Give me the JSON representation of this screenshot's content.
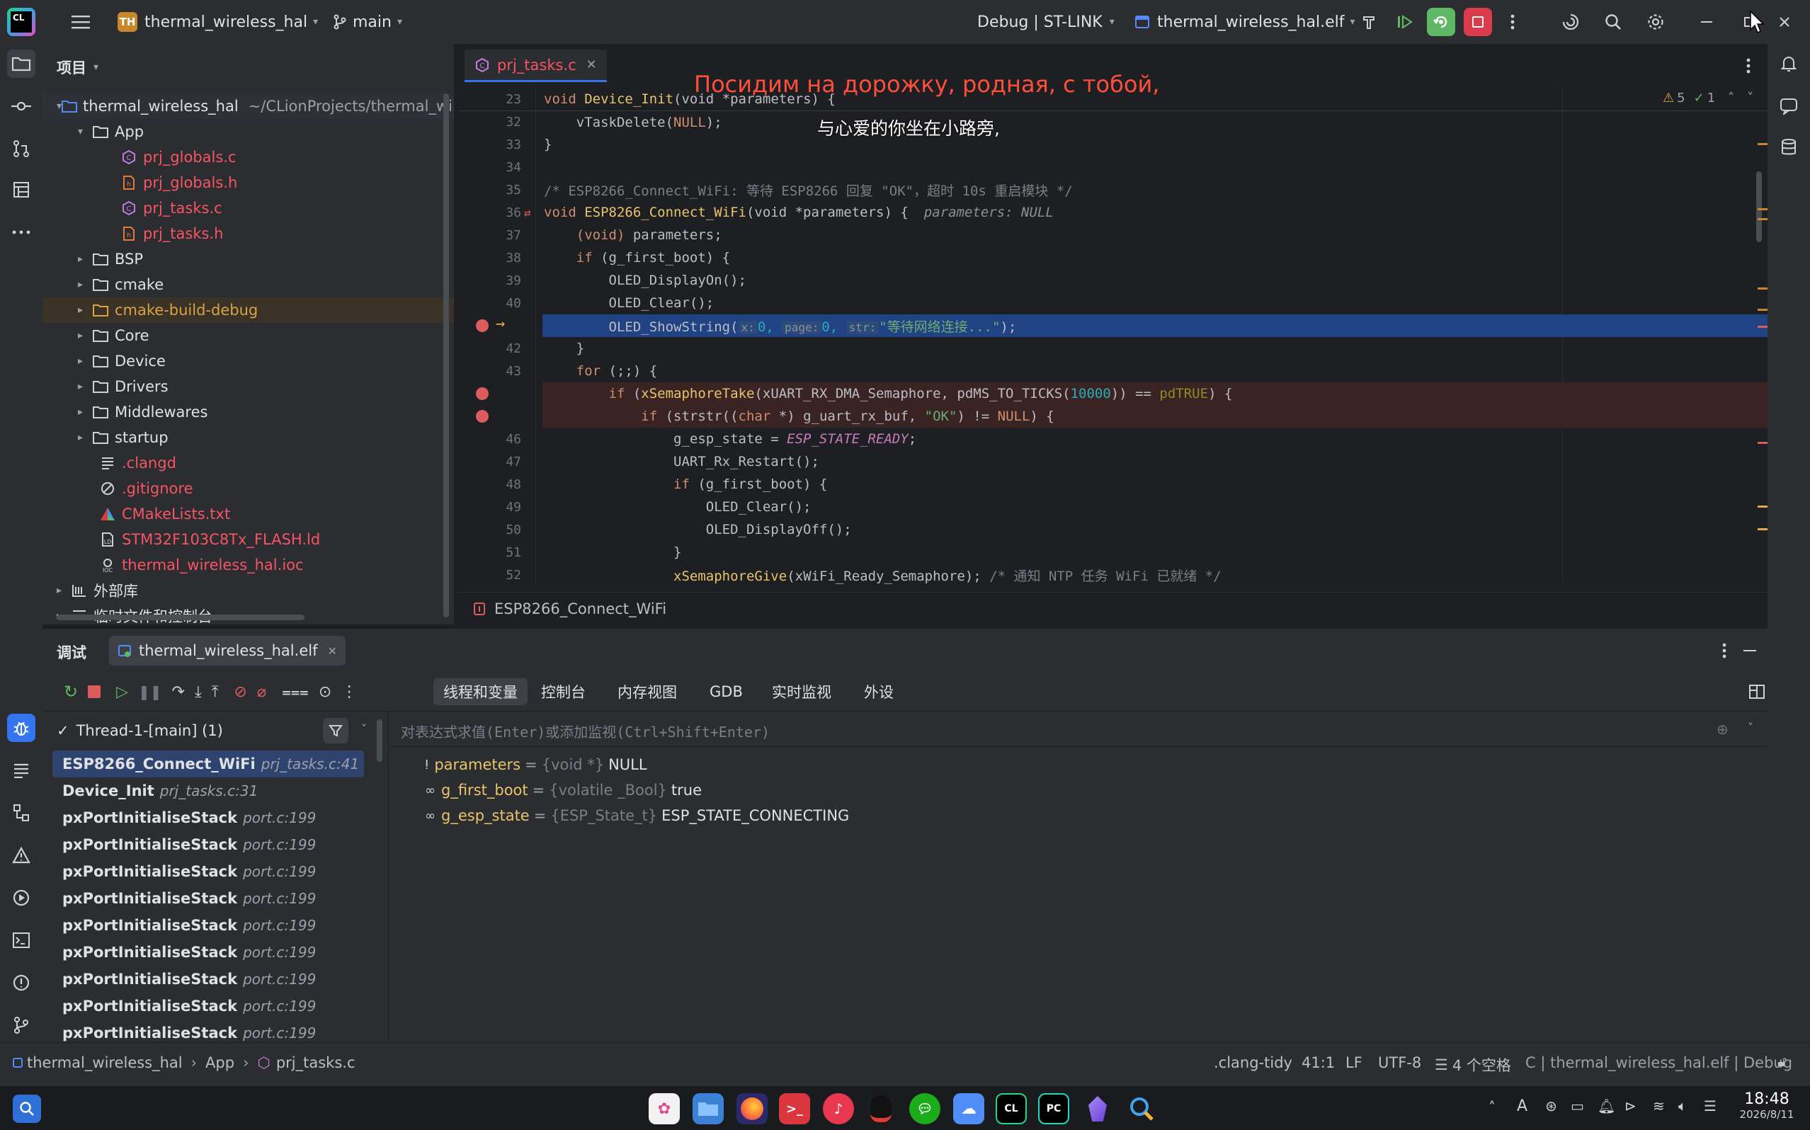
{
  "titlebar": {
    "project_badge": "TH",
    "project_name": "thermal_wireless_hal",
    "branch": "main",
    "run_config": "Debug | ST-LINK",
    "target": "thermal_wireless_hal.elf"
  },
  "project_panel": {
    "title": "项目",
    "root_name": "thermal_wireless_hal",
    "root_path": "~/CLionProjects/thermal_wire",
    "items": [
      {
        "label": "App",
        "type": "folder"
      },
      {
        "label": "prj_globals.c",
        "type": "c-file"
      },
      {
        "label": "prj_globals.h",
        "type": "h-file"
      },
      {
        "label": "prj_tasks.c",
        "type": "c-file"
      },
      {
        "label": "prj_tasks.h",
        "type": "h-file"
      },
      {
        "label": "BSP",
        "type": "folder"
      },
      {
        "label": "cmake",
        "type": "folder"
      },
      {
        "label": "cmake-build-debug",
        "type": "folder"
      },
      {
        "label": "Core",
        "type": "folder"
      },
      {
        "label": "Device",
        "type": "folder"
      },
      {
        "label": "Drivers",
        "type": "folder"
      },
      {
        "label": "Middlewares",
        "type": "folder"
      },
      {
        "label": "startup",
        "type": "folder"
      },
      {
        "label": ".clangd",
        "type": "file"
      },
      {
        "label": ".gitignore",
        "type": "file"
      },
      {
        "label": "CMakeLists.txt",
        "type": "file"
      },
      {
        "label": "STM32F103C8Tx_FLASH.ld",
        "type": "file"
      },
      {
        "label": "thermal_wireless_hal.ioc",
        "type": "file"
      },
      {
        "label": "外部库",
        "type": "lib"
      },
      {
        "label": "临时文件和控制台",
        "type": "scratch"
      }
    ]
  },
  "editor": {
    "tab_label": "prj_tasks.c",
    "warnings": "5",
    "checks": "1",
    "breadcrumb_fn": "ESP8266_Connect_WiFi",
    "overlay_lyric_1": "Посидим на дорожку, родная, с тобой,",
    "overlay_lyric_2": "与心爱的你坐在小路旁,",
    "line_numbers": [
      "23",
      "32",
      "33",
      "34",
      "35",
      "36",
      "37",
      "38",
      "39",
      "40",
      "",
      "42",
      "43",
      "",
      "",
      "46",
      "47",
      "48",
      "49",
      "50",
      "51",
      "52"
    ],
    "lines": {
      "l23a": "void ",
      "l23b": "Device_Init",
      "l23c": "(void *parameters) {",
      "l32a": "    vTaskDelete(",
      "l32b": "NULL",
      "l32c": ");",
      "l33": "}",
      "l35": "/* ESP8266_Connect_WiFi: 等待 ESP8266 回复 \"OK\"，超时 10s 重启模块 */",
      "l36a": "void ",
      "l36b": "ESP8266_Connect_WiFi",
      "l36c": "(void *parameters) {",
      "l36hint": "parameters: NULL",
      "l37a": "    (void) ",
      "l37b": "parameters;",
      "l38a": "    if ",
      "l38b": "(g_first_boot) {",
      "l39": "        OLED_DisplayOn();",
      "l40": "        OLED_Clear();",
      "l41a": "        OLED_ShowString(",
      "l41x": "x:",
      "l41xv": "0,",
      "l41p": "page:",
      "l41pv": "0,",
      "l41s": "str:",
      "l41sv": "\"等待网络连接...\"",
      "l41e": ");",
      "l42": "    }",
      "l43a": "    for ",
      "l43b": "(;;) {",
      "l44a": "        if ",
      "l44b": "(",
      "l44c": "xSemaphoreTake",
      "l44d": "(xUART_RX_DMA_Semaphore, pdMS_TO_TICKS(",
      "l44e": "10000",
      "l44f": ")) == ",
      "l44g": "pdTRUE",
      "l44h": ") {",
      "l45a": "            if ",
      "l45b": "(strstr((",
      "l45c": "char ",
      "l45d": "*) g_uart_rx_buf, ",
      "l45e": "\"OK\"",
      "l45f": ") != ",
      "l45g": "NULL",
      "l45h": ") {",
      "l46a": "                g_esp_state = ",
      "l46b": "ESP_STATE_READY",
      "l46c": ";",
      "l47": "                UART_Rx_Restart();",
      "l48a": "                if ",
      "l48b": "(g_first_boot) {",
      "l49": "                    OLED_Clear();",
      "l50": "                    OLED_DisplayOff();",
      "l51": "                }",
      "l52a": "                ",
      "l52b": "xSemaphoreGive",
      "l52c": "(xWiFi_Ready_Semaphore); ",
      "l52d": "/* 通知 NTP 任务 WiFi 已就绪 */"
    }
  },
  "debug": {
    "title": "调试",
    "session_tab": "thermal_wireless_hal.elf",
    "tabs": [
      "线程和变量",
      "控制台",
      "内存视图",
      "GDB",
      "实时监视",
      "外设"
    ],
    "thread": "Thread-1-[main] (1)",
    "eval_placeholder": "对表达式求值(Enter)或添加监视(Ctrl+Shift+Enter)",
    "frames": [
      {
        "fn": "ESP8266_Connect_WiFi",
        "loc": "prj_tasks.c:41"
      },
      {
        "fn": "Device_Init",
        "loc": "prj_tasks.c:31"
      },
      {
        "fn": "pxPortInitialiseStack",
        "loc": "port.c:199"
      },
      {
        "fn": "pxPortInitialiseStack",
        "loc": "port.c:199"
      },
      {
        "fn": "pxPortInitialiseStack",
        "loc": "port.c:199"
      },
      {
        "fn": "pxPortInitialiseStack",
        "loc": "port.c:199"
      },
      {
        "fn": "pxPortInitialiseStack",
        "loc": "port.c:199"
      },
      {
        "fn": "pxPortInitialiseStack",
        "loc": "port.c:199"
      },
      {
        "fn": "pxPortInitialiseStack",
        "loc": "port.c:199"
      },
      {
        "fn": "pxPortInitialiseStack",
        "loc": "port.c:199"
      },
      {
        "fn": "pxPortInitialiseStack",
        "loc": "port.c:199"
      }
    ],
    "variables": [
      {
        "name": "parameters",
        "type": "{void *}",
        "value": "NULL"
      },
      {
        "name": "g_first_boot",
        "type": "{volatile _Bool}",
        "value": "true"
      },
      {
        "name": "g_esp_state",
        "type": "{ESP_State_t}",
        "value": "ESP_STATE_CONNECTING"
      }
    ]
  },
  "statusbar": {
    "crumb_project": "thermal_wireless_hal",
    "crumb_folder": "App",
    "crumb_file": "prj_tasks.c",
    "clang_tidy": ".clang-tidy",
    "position": "41:1",
    "line_sep": "LF",
    "encoding": "UTF-8",
    "indent": "4 个空格",
    "context": "C | thermal_wireless_hal.elf | Debug"
  },
  "taskbar": {
    "time": "18:48",
    "date": "2026/8/11"
  },
  "colors": {
    "accent": "#3574f0",
    "selection": "#214283",
    "breakpoint_line": "#3a2323",
    "overlay_text": "#ff4e3c"
  }
}
